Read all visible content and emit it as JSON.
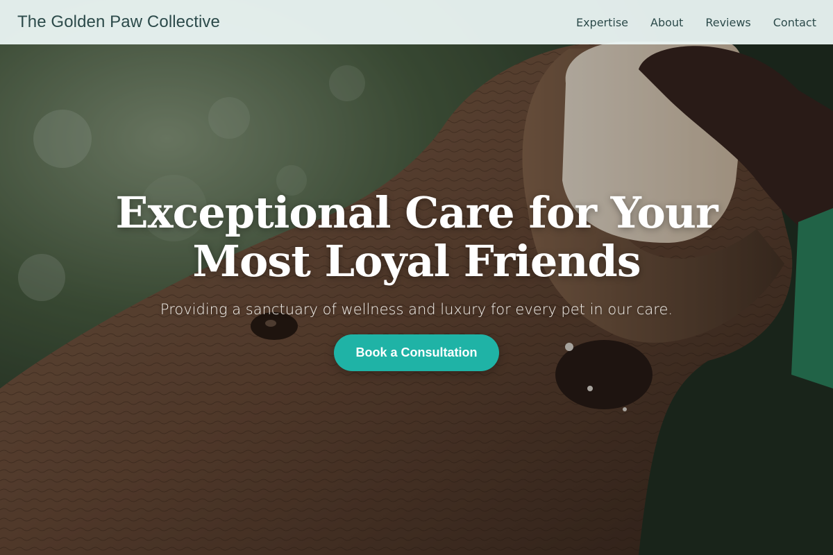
{
  "site": {
    "brand": "The Golden Paw Collective"
  },
  "nav": {
    "links": [
      "Expertise",
      "About",
      "Reviews",
      "Contact"
    ]
  },
  "hero": {
    "title_line1": "Exceptional Care for Your",
    "title_line2": "Most Loyal Friends",
    "subtitle": "Providing a sanctuary of wellness and luxury for every pet in our care.",
    "cta_label": "Book a Consultation"
  },
  "colors": {
    "accent": "#1fb3a6",
    "nav_bg": "#ecf7f5",
    "nav_text": "#2c4a4a",
    "hero_text": "#ffffff"
  },
  "icons": {
    "hero_image": "elephant-feeding-photo"
  }
}
